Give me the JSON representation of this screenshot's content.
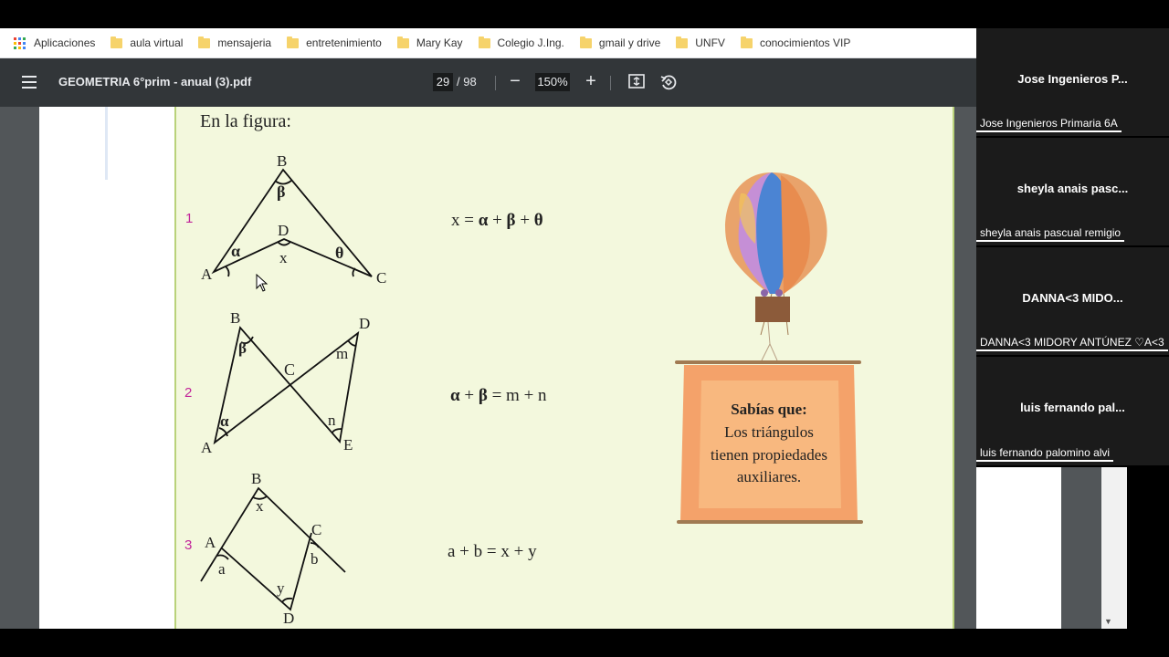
{
  "bookmarks": {
    "apps_label": "Aplicaciones",
    "items": [
      "aula virtual",
      "mensajeria",
      "entretenimiento",
      "Mary Kay",
      "Colegio J.Ing.",
      "gmail y drive",
      "UNFV",
      "conocimientos VIP"
    ]
  },
  "pdf_toolbar": {
    "title": "GEOMETRIA 6°prim - anual (3).pdf",
    "current_page": "29",
    "total_pages": "/ 98",
    "zoom": "150%",
    "zoom_out": "−",
    "zoom_in": "+"
  },
  "page": {
    "intro": "En la figura:",
    "problems": [
      {
        "number": "1",
        "formula_parts": [
          "x = ",
          "α",
          " + ",
          "β",
          " + ",
          "θ"
        ]
      },
      {
        "number": "2",
        "formula_parts": [
          "α",
          " + ",
          "β",
          " = m + n"
        ]
      },
      {
        "number": "3",
        "formula_parts": [
          "a + b = x + y"
        ]
      }
    ],
    "fig1": {
      "B": "B",
      "D": "D",
      "A": "A",
      "C": "C",
      "beta": "β",
      "alpha": "α",
      "theta": "θ",
      "x": "x"
    },
    "fig2": {
      "B": "B",
      "D": "D",
      "A": "A",
      "E": "E",
      "C": "C",
      "beta": "β",
      "alpha": "α",
      "m": "m",
      "n": "n"
    },
    "fig3": {
      "B": "B",
      "A": "A",
      "C": "C",
      "D": "D",
      "x": "x",
      "a": "a",
      "b": "b",
      "y": "y"
    },
    "sign": {
      "title": "Sabías que:",
      "lines": [
        "Los triángulos",
        "tienen propiedades",
        "auxiliares."
      ]
    }
  },
  "participants": [
    {
      "tile_name": "Jose Ingenieros P...",
      "full_name": "Jose Ingenieros Primaria 6A"
    },
    {
      "tile_name": "sheyla anais pasc...",
      "full_name": "sheyla anais pascual remigio"
    },
    {
      "tile_name": "DANNA<3 MIDO...",
      "full_name": "DANNA<3 MIDORY ANTÚNEZ ♡A<3"
    },
    {
      "tile_name": "luis fernando pal...",
      "full_name": "luis fernando palomino alvi"
    }
  ],
  "colors": {
    "page_bg": "#f3f8dd",
    "toolbar_bg": "#323639",
    "problem_number": "#c2259a",
    "sign_fill": "#f4a26a"
  }
}
